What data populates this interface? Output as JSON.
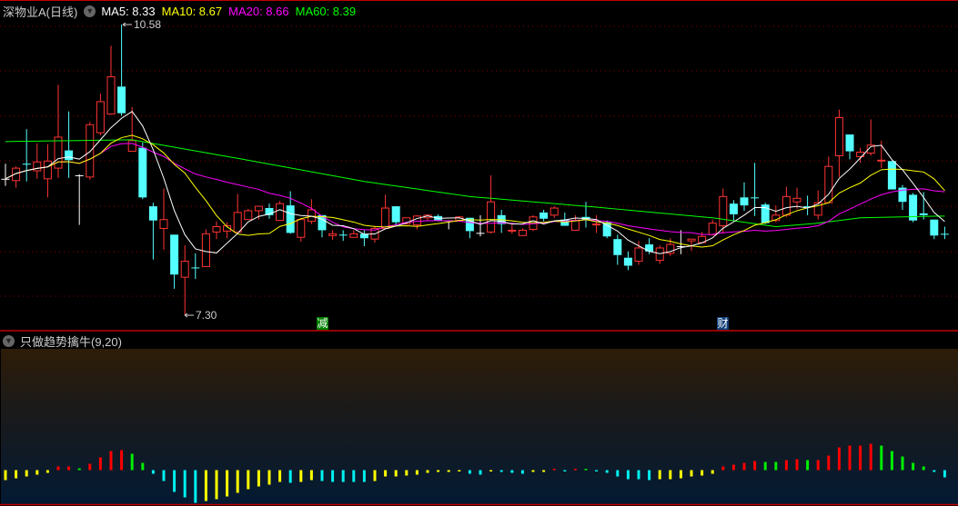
{
  "header": {
    "title": "深物业A(日线)",
    "ma5": "MA5: 8.33",
    "ma10": "MA10: 8.67",
    "ma20": "MA20: 8.66",
    "ma60": "MA60: 8.39"
  },
  "colors": {
    "up": "#ff3333",
    "down": "#54ffff",
    "flat": "#ffffff",
    "ma5": "#ffffff",
    "ma10": "#ffff00",
    "ma20": "#ff00ff",
    "ma60": "#00ff00",
    "grid": "#8b0000",
    "ind_red": "#ff0000",
    "ind_green": "#00ee00",
    "ind_cyan": "#00f0f0",
    "ind_yellow": "#ffff00"
  },
  "price_labels": {
    "high": "10.58",
    "low": "7.30"
  },
  "markers": [
    {
      "text": "减",
      "color": "#008000"
    },
    {
      "text": "财",
      "color": "#0f3e78"
    }
  ],
  "indicator": {
    "title": "只做趋势擒牛(9,20)"
  },
  "chart_data": {
    "type": "candlestick",
    "ohlc_format": [
      "open",
      "close",
      "high",
      "low"
    ],
    "price_range": [
      7.3,
      10.58
    ],
    "candles": [
      [
        8.84,
        8.84,
        9.01,
        8.76
      ],
      [
        8.82,
        8.96,
        8.98,
        8.74
      ],
      [
        9.01,
        9.0,
        9.4,
        8.81
      ],
      [
        8.93,
        9.03,
        9.24,
        8.84
      ],
      [
        8.84,
        9.04,
        9.23,
        8.63
      ],
      [
        8.96,
        9.31,
        9.9,
        8.85
      ],
      [
        9.16,
        9.05,
        9.6,
        8.85
      ],
      [
        8.88,
        8.88,
        8.89,
        8.32
      ],
      [
        8.86,
        9.45,
        9.48,
        8.83
      ],
      [
        9.36,
        9.71,
        9.8,
        9.33
      ],
      [
        9.57,
        9.99,
        10.34,
        9.56
      ],
      [
        9.88,
        9.58,
        10.58,
        9.55
      ],
      [
        9.15,
        9.27,
        9.65,
        9.15
      ],
      [
        9.19,
        8.63,
        9.25,
        8.61
      ],
      [
        8.53,
        8.37,
        8.57,
        7.93
      ],
      [
        8.28,
        8.38,
        8.73,
        8.04
      ],
      [
        8.21,
        7.76,
        8.21,
        7.6
      ],
      [
        7.73,
        7.91,
        8.09,
        7.3
      ],
      [
        7.84,
        7.83,
        8.0,
        7.71
      ],
      [
        7.85,
        8.22,
        8.27,
        7.85
      ],
      [
        8.24,
        8.3,
        8.36,
        8.16
      ],
      [
        8.25,
        8.31,
        8.35,
        8.17
      ],
      [
        8.24,
        8.46,
        8.67,
        8.24
      ],
      [
        8.38,
        8.48,
        8.5,
        8.38
      ],
      [
        8.48,
        8.53,
        8.53,
        8.38
      ],
      [
        8.51,
        8.43,
        8.56,
        8.39
      ],
      [
        8.37,
        8.56,
        8.59,
        8.37
      ],
      [
        8.54,
        8.23,
        8.7,
        8.22
      ],
      [
        8.18,
        8.38,
        8.38,
        8.13
      ],
      [
        8.36,
        8.49,
        8.61,
        8.33
      ],
      [
        8.43,
        8.26,
        8.43,
        8.18
      ],
      [
        8.2,
        8.22,
        8.26,
        8.15
      ],
      [
        8.21,
        8.2,
        8.26,
        8.14
      ],
      [
        8.18,
        8.22,
        8.26,
        8.18
      ],
      [
        8.22,
        8.17,
        8.26,
        8.08
      ],
      [
        8.16,
        8.28,
        8.31,
        8.12
      ],
      [
        8.28,
        8.51,
        8.66,
        8.28
      ],
      [
        8.53,
        8.35,
        8.53,
        8.31
      ],
      [
        8.33,
        8.4,
        8.4,
        8.33
      ],
      [
        8.32,
        8.42,
        8.43,
        8.27
      ],
      [
        8.4,
        8.43,
        8.44,
        8.37
      ],
      [
        8.42,
        8.37,
        8.44,
        8.36
      ],
      [
        8.37,
        8.37,
        8.37,
        8.27
      ],
      [
        8.37,
        8.41,
        8.42,
        8.36
      ],
      [
        8.4,
        8.25,
        8.4,
        8.17
      ],
      [
        8.23,
        8.23,
        8.43,
        8.19
      ],
      [
        8.24,
        8.58,
        8.88,
        8.22
      ],
      [
        8.43,
        8.33,
        8.49,
        8.23
      ],
      [
        8.25,
        8.26,
        8.32,
        8.22
      ],
      [
        8.2,
        8.26,
        8.28,
        8.2
      ],
      [
        8.27,
        8.41,
        8.43,
        8.25
      ],
      [
        8.46,
        8.39,
        8.49,
        8.36
      ],
      [
        8.43,
        8.51,
        8.53,
        8.4
      ],
      [
        8.38,
        8.31,
        8.46,
        8.31
      ],
      [
        8.26,
        8.37,
        8.43,
        8.26
      ],
      [
        8.41,
        8.38,
        8.58,
        8.29
      ],
      [
        8.32,
        8.33,
        8.43,
        8.23
      ],
      [
        8.35,
        8.19,
        8.37,
        8.17
      ],
      [
        8.16,
        7.98,
        8.21,
        7.87
      ],
      [
        7.95,
        7.86,
        8.02,
        7.81
      ],
      [
        7.91,
        8.06,
        8.14,
        7.87
      ],
      [
        8.1,
        8.02,
        8.17,
        7.99
      ],
      [
        7.92,
        8.06,
        8.09,
        7.88
      ],
      [
        8.0,
        8.1,
        8.17,
        7.97
      ],
      [
        8.08,
        8.08,
        8.26,
        7.99
      ],
      [
        8.14,
        8.16,
        8.16,
        8.03
      ],
      [
        8.12,
        8.19,
        8.24,
        8.11
      ],
      [
        8.21,
        8.34,
        8.38,
        8.2
      ],
      [
        8.31,
        8.64,
        8.73,
        8.22
      ],
      [
        8.56,
        8.44,
        8.6,
        8.37
      ],
      [
        8.63,
        8.54,
        8.8,
        8.48
      ],
      [
        8.63,
        8.62,
        9.02,
        8.42
      ],
      [
        8.55,
        8.34,
        8.57,
        8.33
      ],
      [
        8.37,
        8.43,
        8.54,
        8.35
      ],
      [
        8.43,
        8.64,
        8.75,
        8.41
      ],
      [
        8.58,
        8.62,
        8.74,
        8.5
      ],
      [
        8.53,
        8.52,
        8.65,
        8.43
      ],
      [
        8.43,
        8.57,
        8.71,
        8.38
      ],
      [
        8.57,
        8.98,
        9.09,
        8.57
      ],
      [
        9.1,
        9.53,
        9.62,
        8.86
      ],
      [
        9.34,
        9.15,
        9.34,
        9.06
      ],
      [
        9.09,
        9.14,
        9.19,
        9.02
      ],
      [
        9.13,
        9.22,
        9.51,
        9.1
      ],
      [
        9.04,
        9.05,
        9.27,
        8.96
      ],
      [
        9.04,
        8.72,
        9.04,
        8.72
      ],
      [
        8.74,
        8.58,
        8.77,
        8.49
      ],
      [
        8.66,
        8.37,
        8.68,
        8.35
      ],
      [
        8.45,
        8.43,
        8.69,
        8.38
      ],
      [
        8.38,
        8.2,
        8.38,
        8.16
      ],
      [
        8.22,
        8.21,
        8.3,
        8.16
      ]
    ],
    "ma60_knots": [
      [
        0,
        9.26
      ],
      [
        12,
        9.28
      ],
      [
        23,
        9.05
      ],
      [
        34,
        8.81
      ],
      [
        44,
        8.64
      ],
      [
        56,
        8.52
      ],
      [
        67,
        8.4
      ],
      [
        73,
        8.3
      ],
      [
        77,
        8.34
      ],
      [
        81,
        8.4
      ],
      [
        89,
        8.42
      ]
    ],
    "indicator_values": [
      -11,
      -9,
      -7,
      -5,
      -3,
      4,
      4,
      2,
      7,
      14,
      21,
      22,
      18,
      8,
      -4,
      -12,
      -24,
      -30,
      -36,
      -34,
      -32,
      -29,
      -25,
      -21,
      -18,
      -16,
      -13,
      -14,
      -13,
      -11,
      -12,
      -13,
      -13,
      -13,
      -13,
      -12,
      -7,
      -7,
      -6,
      -5,
      -3,
      -2,
      -2,
      -1,
      -4,
      -5,
      -1,
      -2,
      -3,
      -4,
      -2,
      -2,
      1,
      -1,
      1,
      1,
      -1,
      -3,
      -7,
      -10,
      -10,
      -11,
      -10,
      -10,
      -9,
      -7,
      -6,
      -4,
      4,
      6,
      8,
      10,
      9,
      9,
      11,
      12,
      11,
      11,
      16,
      25,
      27,
      27,
      29,
      27,
      21,
      15,
      8,
      4,
      -2,
      -8
    ],
    "indicator_colors": "YYYYYRRGRRRRGGCCCCCYYYYYYYYCYYCCCCCYYYYYYYYYCCYCCCYYRCRGCCCCCCYYYYYYRRRRGGRRGRRRRRRGGGGGCC"
  }
}
